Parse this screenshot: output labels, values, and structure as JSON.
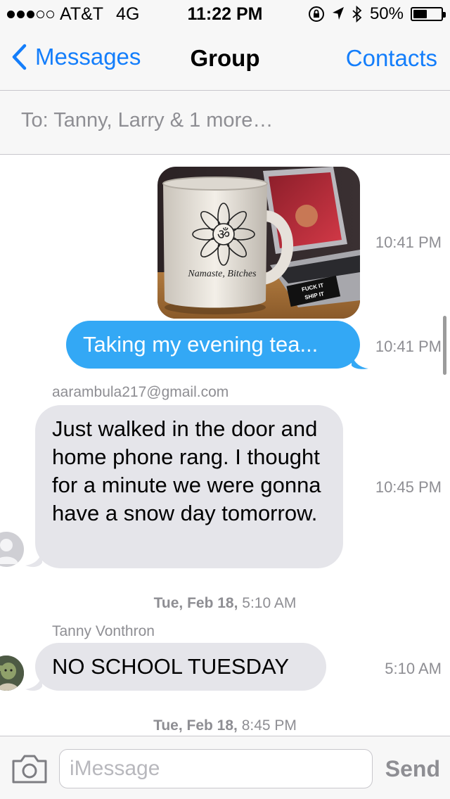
{
  "status_bar": {
    "carrier": "AT&T",
    "network": "4G",
    "time": "11:22 PM",
    "battery": "50%",
    "battery_level": 0.5,
    "signal_bars": 3,
    "signal_total": 5
  },
  "nav": {
    "back_label": "Messages",
    "title": "Group",
    "right_label": "Contacts"
  },
  "to_field": {
    "text": "To: Tanny, Larry & 1 more…"
  },
  "messages": [
    {
      "type": "image",
      "direction": "outgoing",
      "mug_text": "Namaste, Bitches",
      "sticker_text": "FUCK IT SHIP IT",
      "time": "10:41 PM"
    },
    {
      "type": "text",
      "direction": "outgoing",
      "text": "Taking my evening tea...",
      "time": "10:41 PM"
    },
    {
      "type": "text",
      "direction": "incoming",
      "sender": "aarambula217@gmail.com",
      "text": "Just walked in the door and home phone rang. I thought for a minute we were gonna have a snow day tomorrow.",
      "time": "10:45 PM"
    },
    {
      "type": "date",
      "day": "Tue, Feb 18,",
      "time": "5:10 AM"
    },
    {
      "type": "text",
      "direction": "incoming",
      "sender": "Tanny Vonthron",
      "text": "NO SCHOOL TUESDAY",
      "time": "5:10 AM"
    },
    {
      "type": "date",
      "day": "Tue, Feb 18,",
      "time": "8:45 PM"
    }
  ],
  "input": {
    "placeholder": "iMessage",
    "value": "",
    "send_label": "Send"
  },
  "colors": {
    "accent": "#147efb",
    "outgoing_bubble": "#33a8f5",
    "incoming_bubble": "#e5e5ea",
    "meta_text": "#8e8e93"
  }
}
